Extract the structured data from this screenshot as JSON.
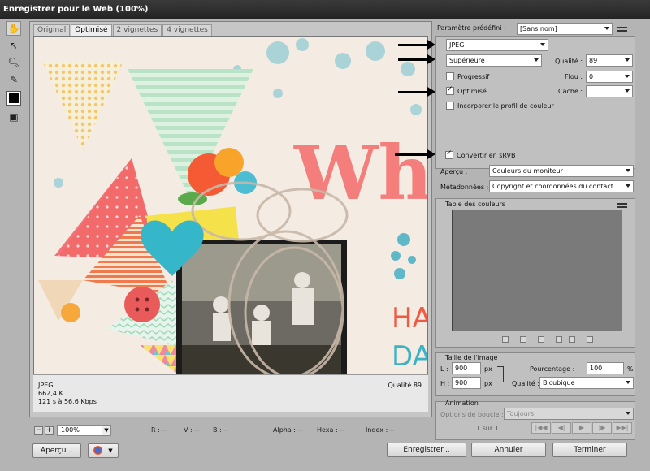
{
  "window": {
    "title": "Enregistrer pour le Web (100%)"
  },
  "tools": [
    "hand-icon",
    "slice-select-icon",
    "zoom-icon",
    "eyedropper-icon"
  ],
  "preview": {
    "tabs": [
      "Original",
      "Optimisé",
      "2 vignettes",
      "4 vignettes"
    ],
    "active_tab": "Optimisé",
    "info": {
      "format": "JPEG",
      "size": "662,4 K",
      "time": "121 s à 56,6 Kbps",
      "quality": "Qualité 89"
    }
  },
  "status": {
    "zoom": "100%",
    "r": "R : --",
    "v": "V : --",
    "b": "B : --",
    "alpha": "Alpha : --",
    "hexa": "Hexa : --",
    "index": "Index : --"
  },
  "settings": {
    "preset_label": "Paramètre prédéfini :",
    "preset_value": "[Sans nom]",
    "format_value": "JPEG",
    "quality_level": "Supérieure",
    "quality_label": "Qualité :",
    "quality_value": "89",
    "progressive_label": "Progressif",
    "progressive_checked": false,
    "blur_label": "Flou :",
    "blur_value": "0",
    "optimized_label": "Optimisé",
    "optimized_checked": true,
    "matte_label": "Cache :",
    "matte_value": "",
    "embed_profile_label": "Incorporer le profil de couleur",
    "embed_profile_checked": false,
    "srgb_label": "Convertir en sRVB",
    "srgb_checked": true,
    "preview_label": "Aperçu :",
    "preview_value": "Couleurs du moniteur",
    "metadata_label": "Métadonnées :",
    "metadata_value": "Copyright et coordonnées du contact"
  },
  "color_table": {
    "title": "Table des couleurs"
  },
  "image_size": {
    "title": "Taille de l'image",
    "width_label": "L :",
    "width_value": "900",
    "height_label": "H :",
    "height_value": "900",
    "unit": "px",
    "percent_label": "Pourcentage :",
    "percent_value": "100",
    "percent_unit": "%",
    "quality_label": "Qualité :",
    "quality_value": "Bicubique"
  },
  "animation": {
    "title": "Animation",
    "loop_label": "Options de boucle :",
    "loop_value": "Toujours",
    "counter": "1 sur 1",
    "controls": [
      "|◀◀",
      "◀|",
      "▶",
      "|▶",
      "▶▶|"
    ]
  },
  "buttons": {
    "preview": "Aperçu...",
    "save": "Enregistrer...",
    "cancel": "Annuler",
    "done": "Terminer"
  },
  "preview_image": {
    "word_top": "Wha",
    "word_bottom_1": "HA",
    "word_bottom_2": "DA"
  }
}
